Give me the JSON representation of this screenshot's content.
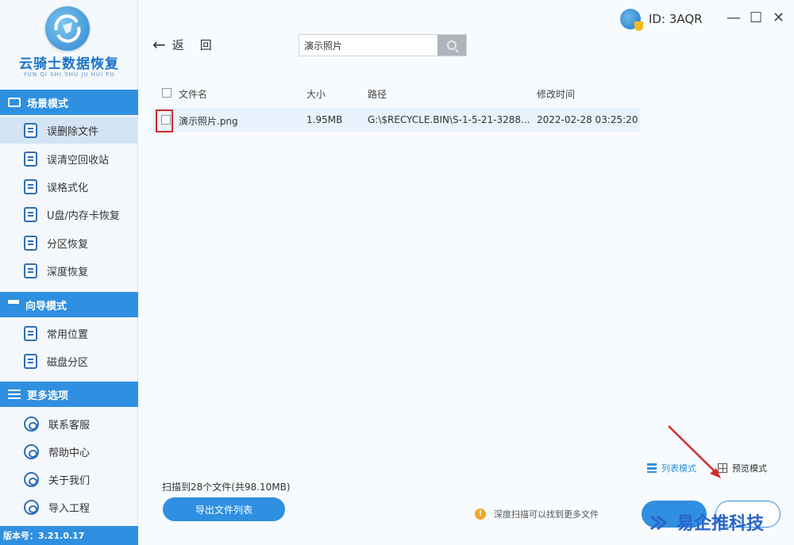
{
  "app": {
    "name": "云骑士数据恢复",
    "subtitle": "YUN QI SHI SHU JU HUI FU",
    "version_label": "版本号：3.21.0.17",
    "id_label": "ID: 3AQR"
  },
  "window_controls": {
    "minimize": "—",
    "maximize": "☐",
    "close": "✕"
  },
  "sidebar": {
    "sections": [
      {
        "title": "场景模式",
        "items": [
          {
            "label": "误删除文件",
            "icon": "recycle-doc-icon",
            "active": true
          },
          {
            "label": "误清空回收站",
            "icon": "recycle-bin-icon"
          },
          {
            "label": "误格式化",
            "icon": "disk-icon"
          },
          {
            "label": "U盘/内存卡恢复",
            "icon": "usb-icon"
          },
          {
            "label": "分区恢复",
            "icon": "partition-icon"
          },
          {
            "label": "深度恢复",
            "icon": "deep-scan-icon"
          }
        ]
      },
      {
        "title": "向导模式",
        "items": [
          {
            "label": "常用位置",
            "icon": "monitor-icon"
          },
          {
            "label": "磁盘分区",
            "icon": "hdd-icon"
          }
        ]
      },
      {
        "title": "更多选项",
        "items": [
          {
            "label": "联系客服",
            "icon": "phone-icon"
          },
          {
            "label": "帮助中心",
            "icon": "help-icon"
          },
          {
            "label": "关于我们",
            "icon": "info-icon"
          },
          {
            "label": "导入工程",
            "icon": "import-icon"
          }
        ]
      }
    ]
  },
  "topbar": {
    "back_label": "返",
    "back_label_2": "回",
    "search_value": "演示照片",
    "search_placeholder": ""
  },
  "table": {
    "headers": [
      "文件名",
      "大小",
      "路径",
      "修改时间"
    ],
    "rows": [
      {
        "name": "演示照片.png",
        "size": "1.95MB",
        "path": "G:\\$RECYCLE.BIN\\S-1-5-21-3288...",
        "modified": "2022-02-28 03:25:20"
      }
    ]
  },
  "footer": {
    "scan_info": "扫描到28个文件(共98.10MB)",
    "export_label": "导出文件列表",
    "view_list_label": "列表模式",
    "view_preview_label": "预览模式",
    "hint_text": "深度扫描可以找到更多文件",
    "btn_left_label": "",
    "btn_right_label": ""
  },
  "watermark": {
    "text": "易企推科技"
  },
  "colors": {
    "accent": "#2f8fe0",
    "highlight_row": "#e8f2fc",
    "annotation_red": "#d52a2a"
  }
}
